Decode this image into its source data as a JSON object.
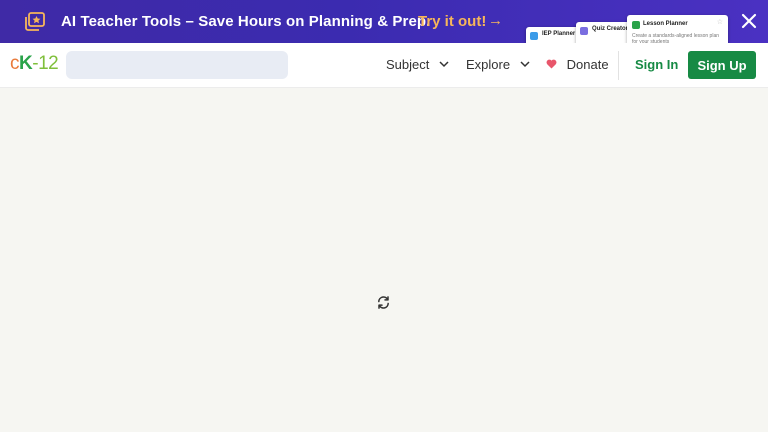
{
  "banner": {
    "headline": "AI Teacher Tools – Save Hours on Planning & Prep.",
    "cta": "Try it out!",
    "cta_arrow": "→",
    "accent_color": "#f7b65a",
    "cards": {
      "iep": {
        "title": "IEP Planner"
      },
      "quiz": {
        "title": "Quiz Creator"
      },
      "lesson": {
        "title": "Lesson Planner",
        "desc": "Create a standards-aligned lesson plan for your students"
      }
    }
  },
  "header": {
    "logo": {
      "c": "c",
      "k": "K",
      "dash": "-",
      "num": "12"
    },
    "search_placeholder": "",
    "nav": {
      "subject": "Subject",
      "explore": "Explore",
      "donate": "Donate"
    },
    "signin": "Sign In",
    "signup": "Sign Up",
    "brand_color": "#178a44"
  },
  "main": {
    "loading_icon": "refresh-spinner-icon"
  }
}
